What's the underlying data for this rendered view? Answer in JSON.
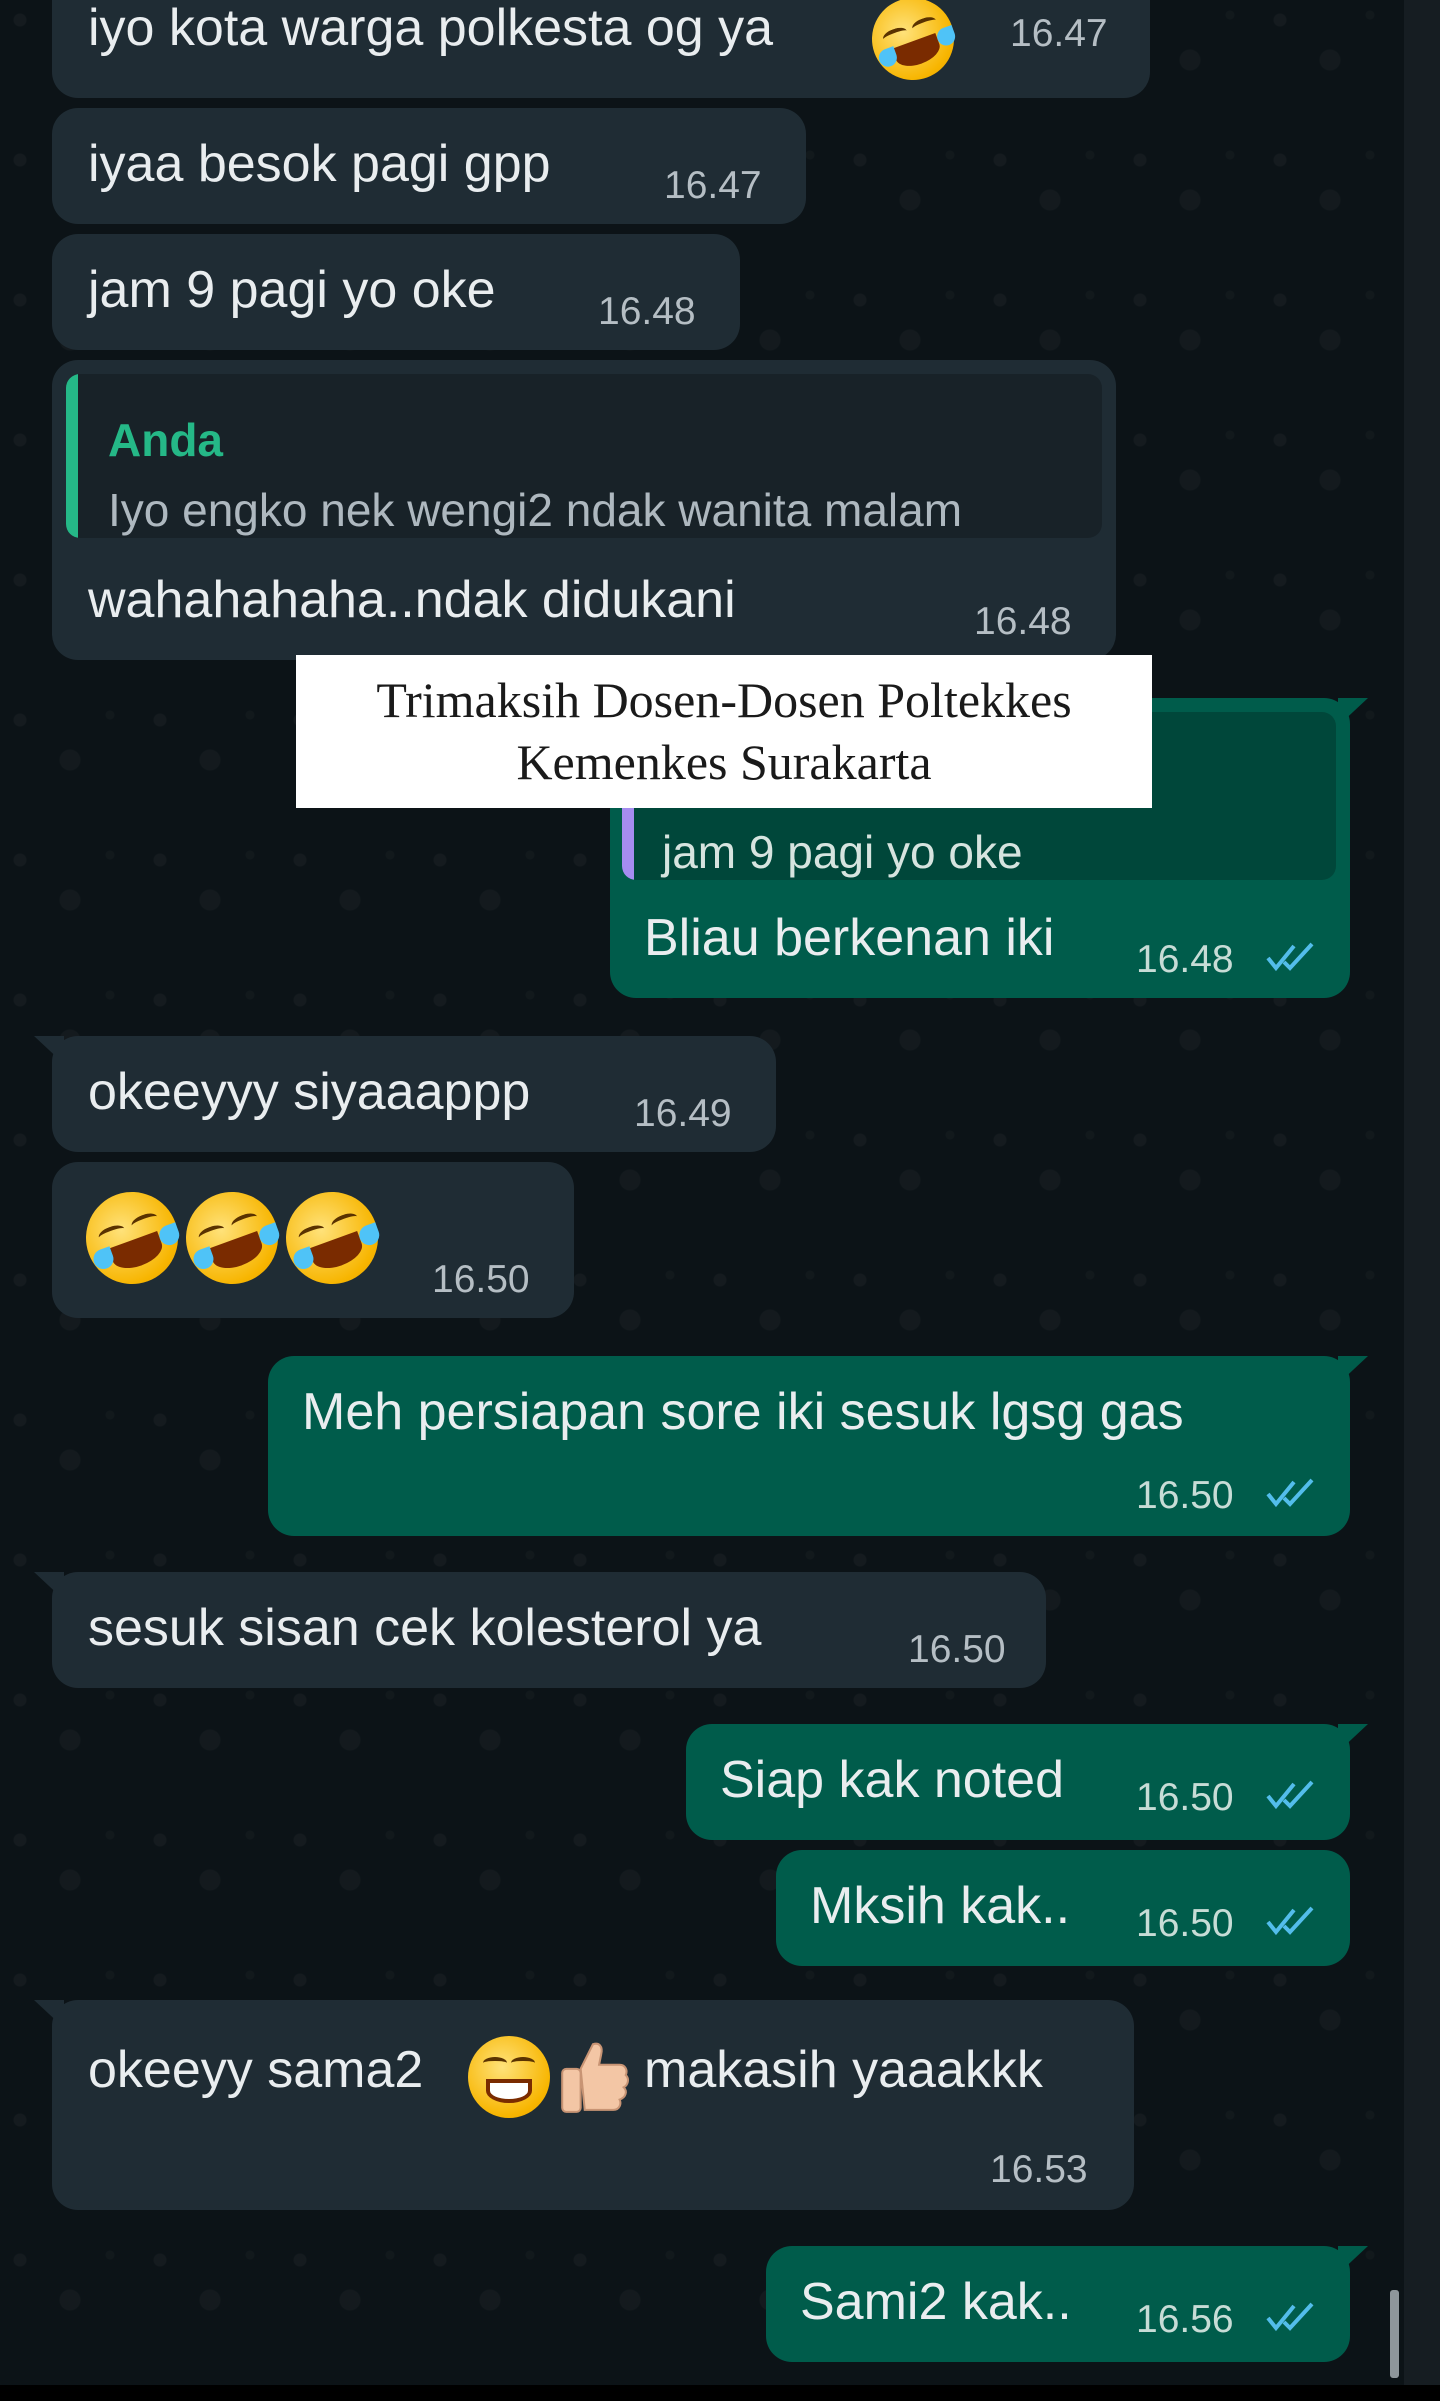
{
  "colors": {
    "chat_background": "#0c1317",
    "incoming_bubble": "#1f2c34",
    "outgoing_bubble": "#005c4b",
    "text": "#e9edef",
    "quote_author_green": "#25b887",
    "quote_bar_purple": "#a58cf0",
    "read_ticks": "#53bdeb"
  },
  "messages": [
    {
      "direction": "in",
      "text": "iyo kota warga polkesta og ya",
      "emoji": "rolling-on-floor-laughing",
      "time": "16.47"
    },
    {
      "direction": "in",
      "text": "iyaa besok pagi gpp",
      "time": "16.47"
    },
    {
      "direction": "in",
      "text": "jam 9 pagi yo oke",
      "time": "16.48"
    },
    {
      "direction": "in",
      "quote_author": "Anda",
      "quote_text": "Iyo engko nek wengi2 ndak wanita malam",
      "text": "wahahahaha..ndak didukani",
      "time": "16.48"
    },
    {
      "direction": "out",
      "quote_text": "jam 9 pagi yo oke",
      "text": "Bliau berkenan iki",
      "time": "16.48",
      "status": "read"
    },
    {
      "direction": "in",
      "text": "okeeyyy siyaaappp",
      "time": "16.49"
    },
    {
      "direction": "in",
      "emojis": [
        "rolling-on-floor-laughing",
        "rolling-on-floor-laughing",
        "rolling-on-floor-laughing"
      ],
      "time": "16.50"
    },
    {
      "direction": "out",
      "text": "Meh persiapan sore iki sesuk lgsg gas",
      "time": "16.50",
      "status": "read"
    },
    {
      "direction": "in",
      "text": "sesuk sisan cek kolesterol ya",
      "time": "16.50"
    },
    {
      "direction": "out",
      "text": "Siap kak noted",
      "time": "16.50",
      "status": "read"
    },
    {
      "direction": "out",
      "text": "Mksih kak..",
      "time": "16.50",
      "status": "read"
    },
    {
      "direction": "in",
      "text_before": "okeeyy sama2",
      "emojis": [
        "beaming-face",
        "thumbs-up"
      ],
      "text_after": "makasih yaaakkk",
      "time": "16.53"
    },
    {
      "direction": "out",
      "text": "Sami2 kak..",
      "time": "16.56",
      "status": "read"
    }
  ],
  "caption": {
    "line1": "Trimaksih Dosen-Dosen Poltekkes",
    "line2": "Kemenkes Surakarta"
  }
}
